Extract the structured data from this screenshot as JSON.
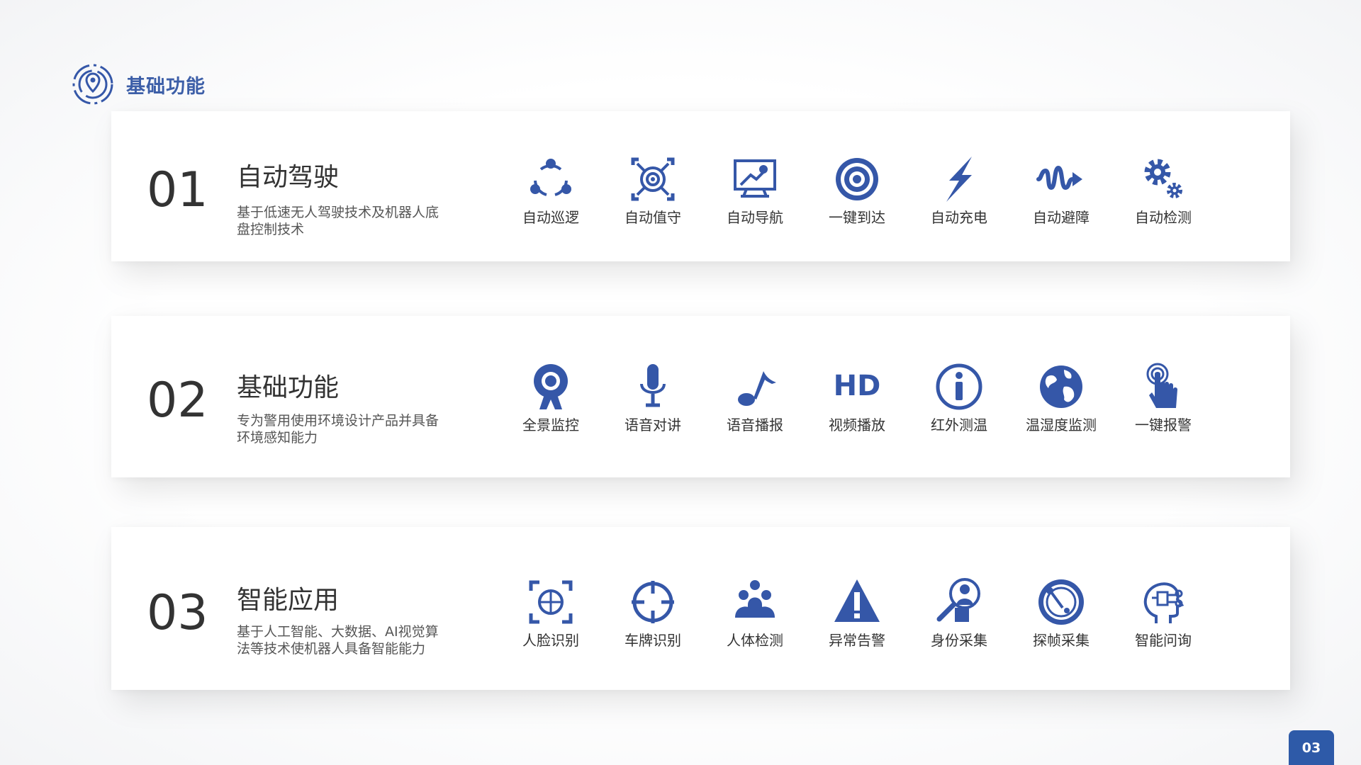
{
  "header": {
    "title": "基础功能",
    "logo_icon": "location-target-icon"
  },
  "accent_color": "#3557a8",
  "sections": [
    {
      "num": "01",
      "title": "自动驾驶",
      "desc": "基于低速无人驾驶技术及机器人底盘控制技术",
      "features": [
        {
          "label": "自动巡逻",
          "icon": "patrol-cycle-icon"
        },
        {
          "label": "自动值守",
          "icon": "guard-target-icon"
        },
        {
          "label": "自动导航",
          "icon": "navigation-monitor-icon"
        },
        {
          "label": "一键到达",
          "icon": "bullseye-icon"
        },
        {
          "label": "自动充电",
          "icon": "lightning-icon"
        },
        {
          "label": "自动避障",
          "icon": "avoid-wave-icon"
        },
        {
          "label": "自动检测",
          "icon": "gears-icon"
        }
      ]
    },
    {
      "num": "02",
      "title": "基础功能",
      "desc": "专为警用使用环境设计产品并具备环境感知能力",
      "features": [
        {
          "label": "全景监控",
          "icon": "webcam-icon"
        },
        {
          "label": "语音对讲",
          "icon": "microphone-icon"
        },
        {
          "label": "语音播报",
          "icon": "music-note-icon"
        },
        {
          "label": "视频播放",
          "icon": "hd-icon"
        },
        {
          "label": "红外测温",
          "icon": "info-icon"
        },
        {
          "label": "温湿度监测",
          "icon": "globe-icon"
        },
        {
          "label": "一键报警",
          "icon": "tap-alarm-icon"
        }
      ]
    },
    {
      "num": "03",
      "title": "智能应用",
      "desc": "基于人工智能、大数据、AI视觉算法等技术使机器人具备智能能力",
      "features": [
        {
          "label": "人脸识别",
          "icon": "face-scan-icon"
        },
        {
          "label": "车牌识别",
          "icon": "crosshair-icon"
        },
        {
          "label": "人体检测",
          "icon": "people-group-icon"
        },
        {
          "label": "异常告警",
          "icon": "warning-icon"
        },
        {
          "label": "身份采集",
          "icon": "person-search-icon"
        },
        {
          "label": "探帧采集",
          "icon": "radar-icon"
        },
        {
          "label": "智能问询",
          "icon": "ai-head-icon"
        }
      ]
    }
  ],
  "page_number": "03"
}
